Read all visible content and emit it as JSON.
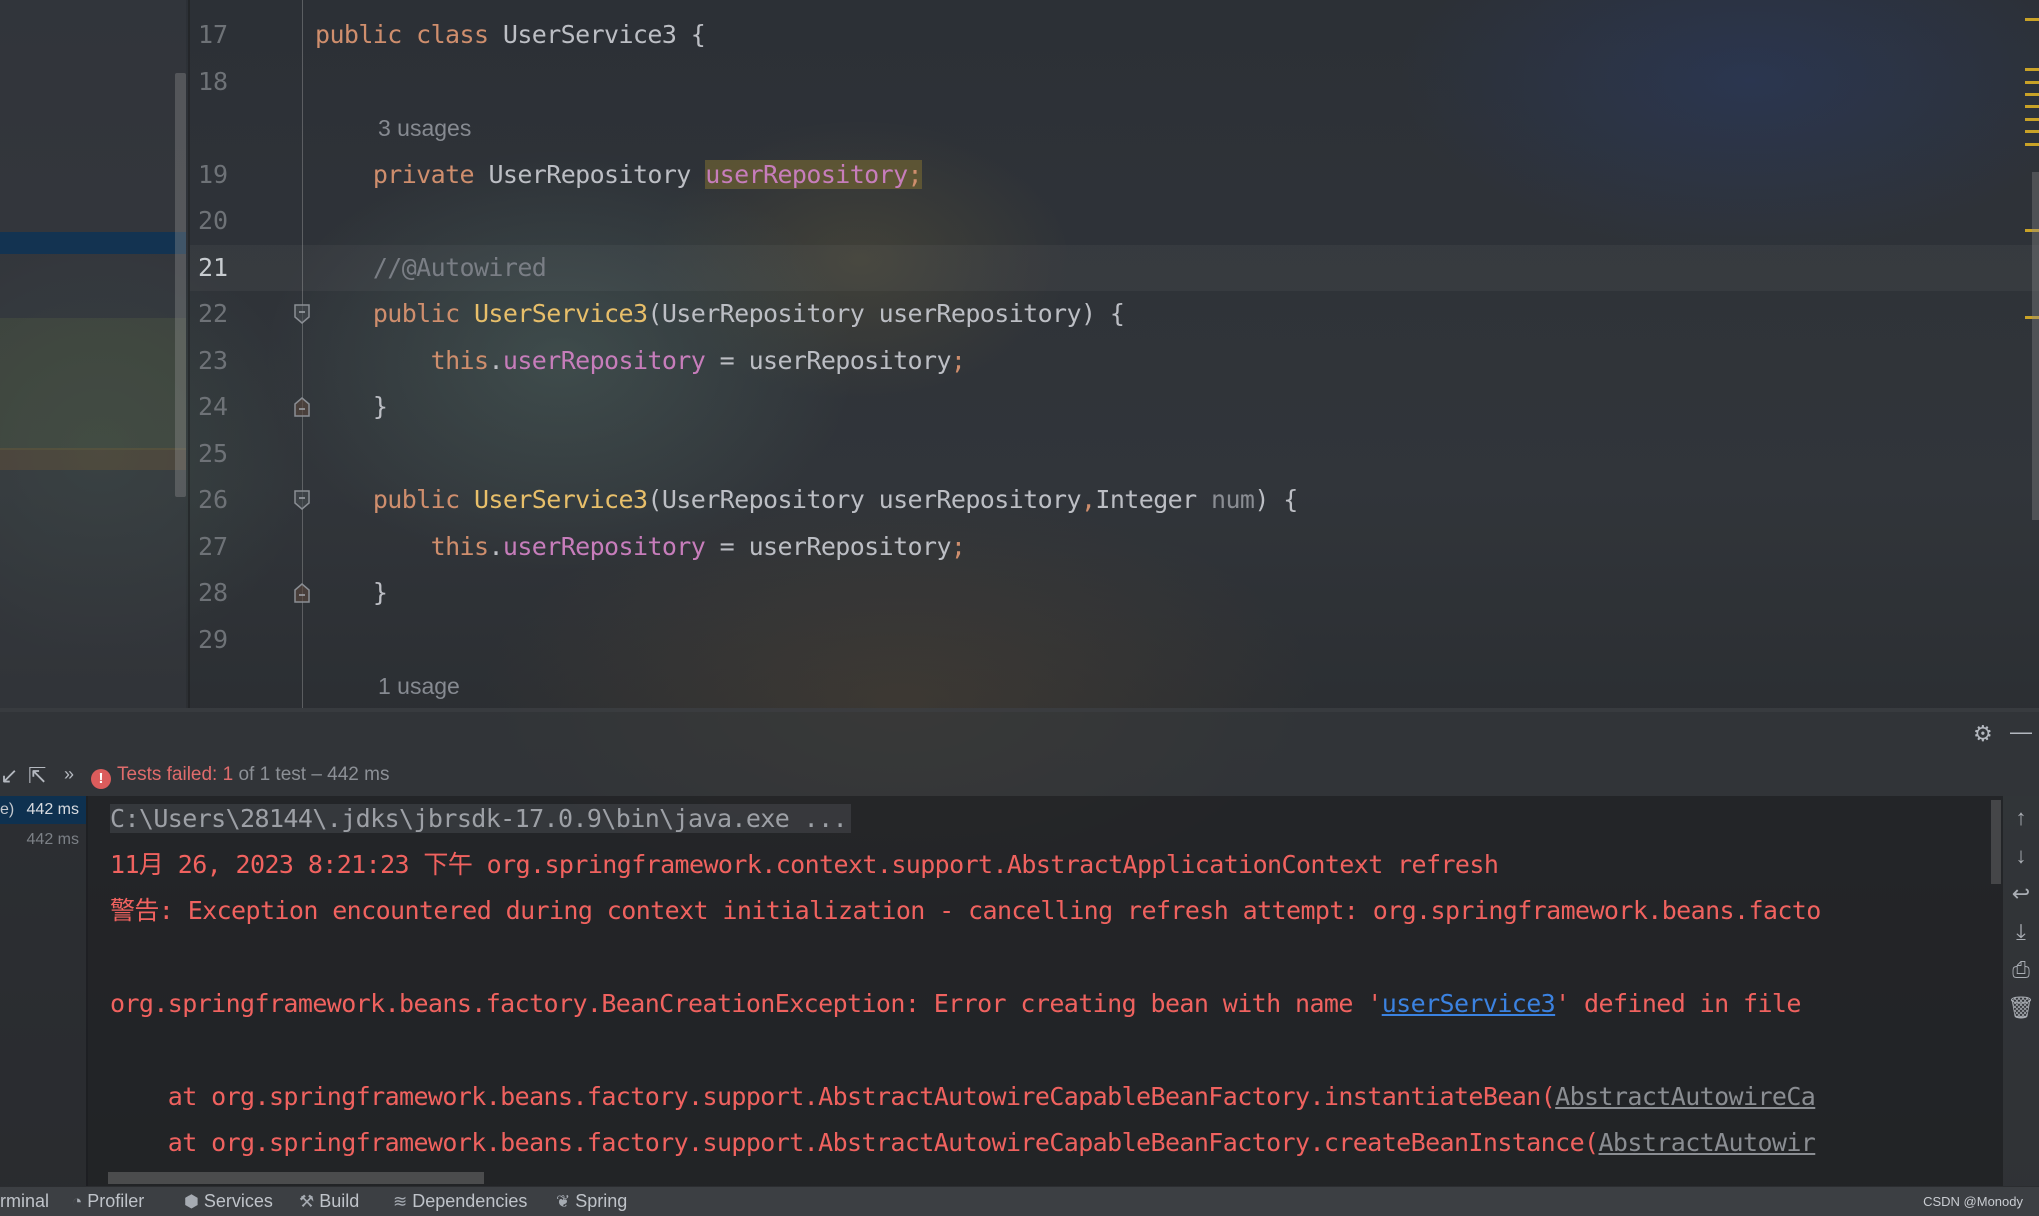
{
  "editor": {
    "lines": [
      {
        "num": "17",
        "type": "class_decl",
        "parts": [
          [
            "kw",
            "public class "
          ],
          [
            "",
            "UserService3 {"
          ]
        ]
      },
      {
        "num": "18",
        "type": "blank",
        "parts": []
      },
      {
        "inlay": "3 usages"
      },
      {
        "num": "19",
        "type": "field",
        "parts": [
          [
            "kw",
            "private "
          ],
          [
            "",
            "UserRepository "
          ],
          [
            "field hl-usage",
            "userRepository"
          ],
          [
            "semi hl-usage",
            ";"
          ]
        ]
      },
      {
        "num": "20",
        "type": "blank",
        "parts": []
      },
      {
        "num": "21",
        "type": "comment",
        "active": true,
        "parts": [
          [
            "cmt",
            "//@Autowired"
          ]
        ]
      },
      {
        "num": "22",
        "type": "ctor",
        "fold": "open",
        "parts": [
          [
            "kw",
            "public "
          ],
          [
            "fn",
            "UserService3"
          ],
          [
            "",
            "(UserRepository userRepository) {"
          ]
        ]
      },
      {
        "num": "23",
        "type": "stmt",
        "parts": [
          [
            "",
            "    "
          ],
          [
            "kw",
            "this"
          ],
          [
            "",
            "."
          ],
          [
            "field",
            "userRepository"
          ],
          [
            "",
            " = userRepository"
          ],
          [
            "semi",
            ";"
          ]
        ]
      },
      {
        "num": "24",
        "type": "close",
        "fold": "close",
        "parts": [
          [
            "",
            "}"
          ]
        ]
      },
      {
        "num": "25",
        "type": "blank",
        "parts": []
      },
      {
        "num": "26",
        "type": "ctor",
        "fold": "open",
        "parts": [
          [
            "kw",
            "public "
          ],
          [
            "fn",
            "UserService3"
          ],
          [
            "",
            "(UserRepository userRepository"
          ],
          [
            "semi",
            ","
          ],
          [
            "",
            "Integer "
          ],
          [
            "param-unused",
            "num"
          ],
          [
            "",
            ") {"
          ]
        ]
      },
      {
        "num": "27",
        "type": "stmt",
        "parts": [
          [
            "",
            "    "
          ],
          [
            "kw",
            "this"
          ],
          [
            "",
            "."
          ],
          [
            "field",
            "userRepository"
          ],
          [
            "",
            " = userRepository"
          ],
          [
            "semi",
            ";"
          ]
        ]
      },
      {
        "num": "28",
        "type": "close",
        "fold": "close",
        "parts": [
          [
            "",
            "}"
          ]
        ]
      },
      {
        "num": "29",
        "type": "blank",
        "parts": []
      },
      {
        "inlay": "1 usage"
      }
    ]
  },
  "run_panel": {
    "status_failed": "Tests failed: 1",
    "status_rest": " of 1 test – 442 ms",
    "tree": [
      {
        "label": "e)",
        "time": "442 ms",
        "selected": true
      },
      {
        "label": "",
        "time": "442 ms",
        "selected": false
      }
    ],
    "console": {
      "command": "C:\\Users\\28144\\.jdks\\jbrsdk-17.0.9\\bin\\java.exe ...",
      "log_header": "11月 26, 2023 8:21:23 下午 org.springframework.context.support.AbstractApplicationContext refresh",
      "warning": "警告: Exception encountered during context initialization - cancelling refresh attempt: org.springframework.beans.facto",
      "exception_prefix": "org.springframework.beans.factory.BeanCreationException: Error creating bean with name '",
      "exception_link": "userService3",
      "exception_suffix": "' defined in file",
      "stack": [
        {
          "prefix": "    at org.springframework.beans.factory.support.AbstractAutowireCapableBeanFactory.instantiateBean(",
          "source": "AbstractAutowireCa"
        },
        {
          "prefix": "    at org.springframework.beans.factory.support.AbstractAutowireCapableBeanFactory.createBeanInstance(",
          "source": "AbstractAutowir"
        }
      ]
    },
    "right_toolbar": [
      "up-arrow-icon",
      "down-arrow-icon",
      "soft-wrap-icon",
      "scroll-to-end-icon",
      "print-icon",
      "trash-icon"
    ]
  },
  "bottom_tabs": [
    {
      "label": "rminal",
      "icon": "terminal-icon"
    },
    {
      "label": "Profiler",
      "icon": "profiler-icon"
    },
    {
      "label": "Services",
      "icon": "services-icon"
    },
    {
      "label": "Build",
      "icon": "hammer-icon"
    },
    {
      "label": "Dependencies",
      "icon": "dependencies-icon"
    },
    {
      "label": "Spring",
      "icon": "spring-leaf-icon"
    }
  ],
  "watermark": "CSDN @Monody",
  "colors": {
    "keyword": "#cf8e6d",
    "method": "#e8bf6a",
    "field": "#c77dbb",
    "error_text": "#f0625f",
    "link": "#3b82e0",
    "selection": "#0e3150",
    "marker": "#c9a227"
  }
}
